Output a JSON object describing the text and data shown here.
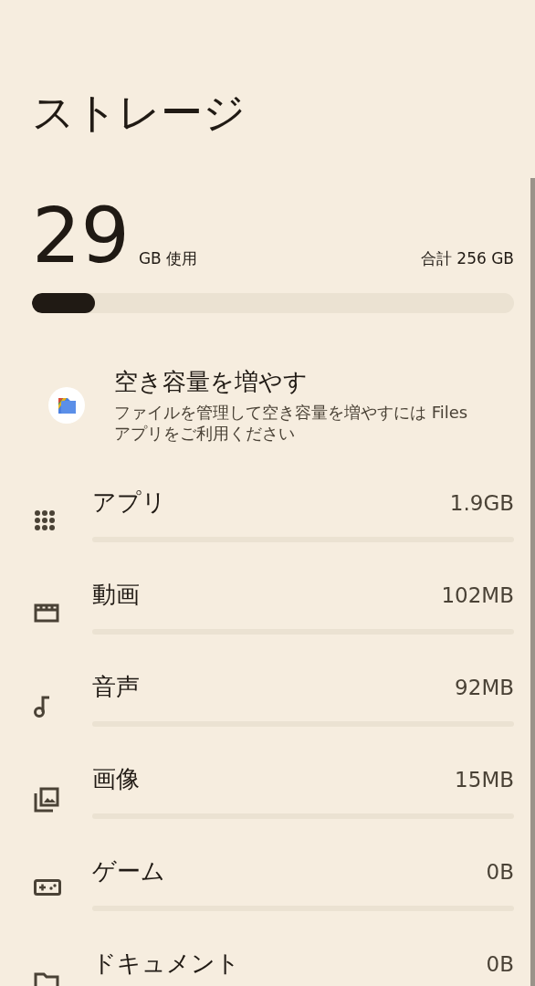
{
  "title": "ストレージ",
  "usage": {
    "amount": "29",
    "unit": "GB 使用",
    "total": "合計 256 GB",
    "level": 0.13
  },
  "promo": {
    "title": "空き容量を増やす",
    "description": "ファイルを管理して空き容量を増やすには Files アプリをご利用ください"
  },
  "categories": [
    {
      "kind": "apps",
      "label": "アプリ",
      "size": "1.9GB"
    },
    {
      "kind": "video",
      "label": "動画",
      "size": "102MB"
    },
    {
      "kind": "audio",
      "label": "音声",
      "size": "92MB"
    },
    {
      "kind": "images",
      "label": "画像",
      "size": "15MB"
    },
    {
      "kind": "games",
      "label": "ゲーム",
      "size": "0B"
    },
    {
      "kind": "documents",
      "label": "ドキュメント",
      "size": "0B"
    }
  ]
}
